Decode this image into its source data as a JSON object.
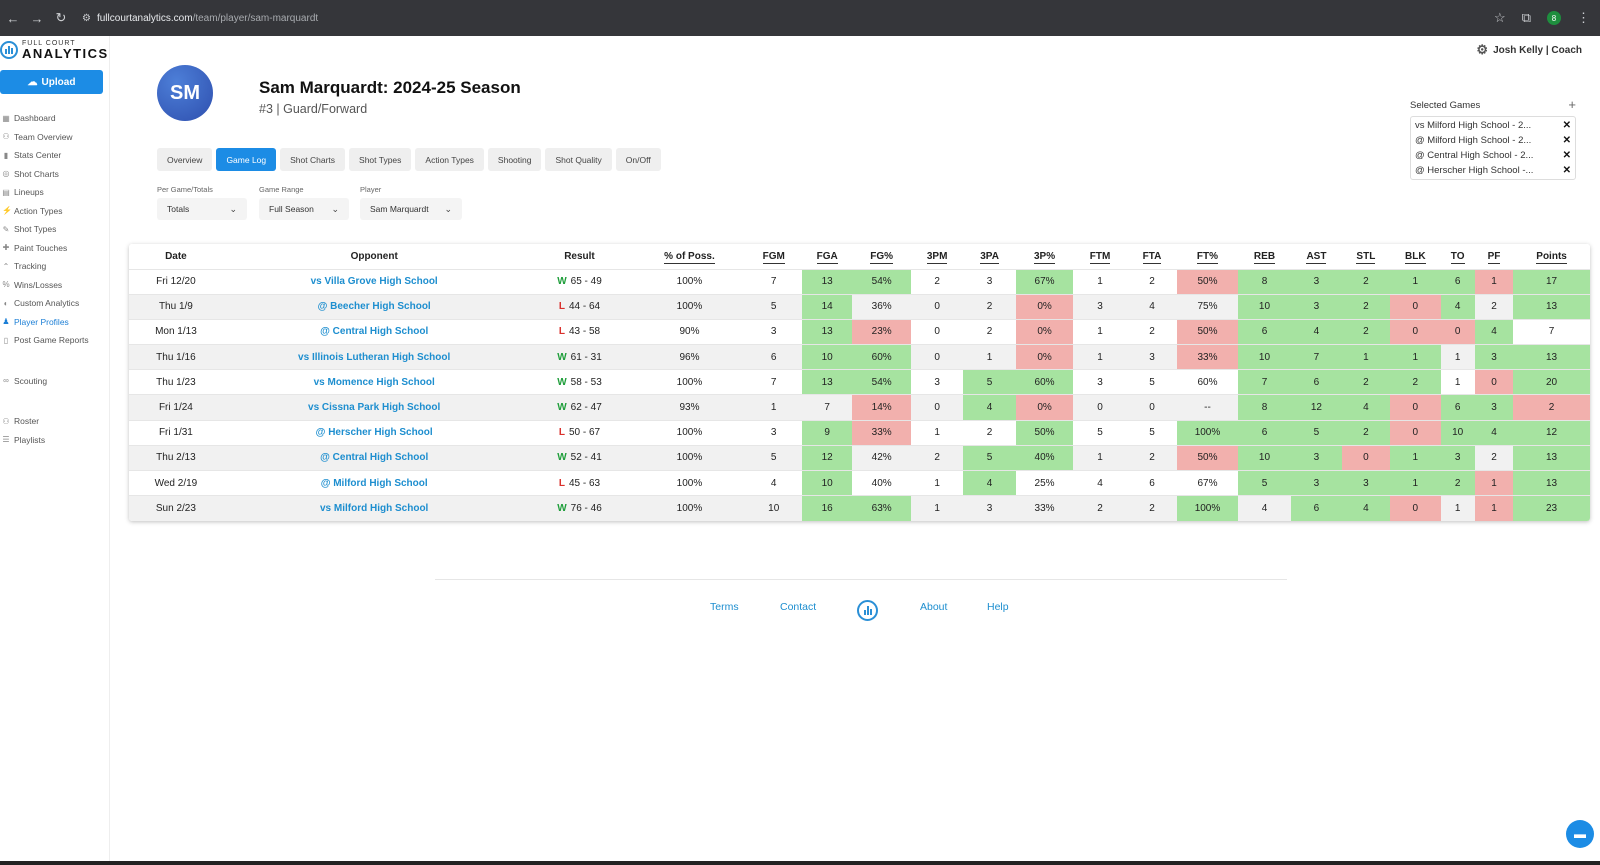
{
  "browser": {
    "url_host": "fullcourtanalytics.com",
    "url_path": "/team/player/sam-marquardt",
    "profile_initial": "8"
  },
  "logo": {
    "top": "FULL COURT",
    "bottom": "ANALYTICS"
  },
  "upload_label": "Upload",
  "sidebar": {
    "items": [
      {
        "label": "Dashboard",
        "icon": "dashboard-icon",
        "glyph": "▦"
      },
      {
        "label": "Team Overview",
        "icon": "team-icon",
        "glyph": "⚇"
      },
      {
        "label": "Stats Center",
        "icon": "stats-icon",
        "glyph": "▮"
      },
      {
        "label": "Shot Charts",
        "icon": "target-icon",
        "glyph": "◎"
      },
      {
        "label": "Lineups",
        "icon": "lineups-icon",
        "glyph": "▤"
      },
      {
        "label": "Action Types",
        "icon": "action-icon",
        "glyph": "⚡"
      },
      {
        "label": "Shot Types",
        "icon": "shot-icon",
        "glyph": "✎"
      },
      {
        "label": "Paint Touches",
        "icon": "paint-icon",
        "glyph": "✚"
      },
      {
        "label": "Tracking",
        "icon": "tracking-icon",
        "glyph": "⌃"
      },
      {
        "label": "Wins/Losses",
        "icon": "percent-icon",
        "glyph": "%"
      },
      {
        "label": "Custom Analytics",
        "icon": "custom-icon",
        "glyph": "◐"
      },
      {
        "label": "Player Profiles",
        "icon": "person-icon",
        "glyph": "♟"
      },
      {
        "label": "Post Game Reports",
        "icon": "report-icon",
        "glyph": "▯"
      }
    ],
    "items2": [
      {
        "label": "Scouting",
        "icon": "binoculars-icon",
        "glyph": "∞"
      }
    ],
    "items3": [
      {
        "label": "Roster",
        "icon": "roster-icon",
        "glyph": "⚇"
      },
      {
        "label": "Playlists",
        "icon": "playlist-icon",
        "glyph": "☰"
      }
    ]
  },
  "user": {
    "name": "Josh Kelly | Coach"
  },
  "player": {
    "initials": "SM",
    "title": "Sam Marquardt: 2024-25 Season",
    "subtitle": "#3 | Guard/Forward"
  },
  "tabs": [
    "Overview",
    "Game Log",
    "Shot Charts",
    "Shot Types",
    "Action Types",
    "Shooting",
    "Shot Quality",
    "On/Off"
  ],
  "filters": {
    "per_game": {
      "label": "Per Game/Totals",
      "value": "Totals"
    },
    "range": {
      "label": "Game Range",
      "value": "Full Season"
    },
    "player": {
      "label": "Player",
      "value": "Sam Marquardt"
    }
  },
  "selected_games": {
    "title": "Selected Games",
    "items": [
      "vs Milford High School - 2...",
      "@ Milford High School - 2...",
      "@ Central High School - 2...",
      "@ Herscher High School -..."
    ]
  },
  "table": {
    "headers": [
      "Date",
      "Opponent",
      "Result",
      "% of Poss.",
      "FGM",
      "FGA",
      "FG%",
      "3PM",
      "3PA",
      "3P%",
      "FTM",
      "FTA",
      "FT%",
      "REB",
      "AST",
      "STL",
      "BLK",
      "TO",
      "PF",
      "Points"
    ],
    "rows": [
      {
        "date": "Fri 12/20",
        "opp": "vs Villa Grove High School",
        "wl": "W",
        "score": "65 - 49",
        "poss": "100%",
        "fgm": "7",
        "fga": "13",
        "fgp": "54%",
        "tpm": "2",
        "tpa": "3",
        "tpp": "67%",
        "ftm": "1",
        "fta": "2",
        "ftp": "50%",
        "reb": "8",
        "ast": "3",
        "stl": "2",
        "blk": "1",
        "to": "6",
        "pf": "1",
        "pts": "17",
        "hl": {
          "fga": "g",
          "fgp": "g",
          "tpp": "g",
          "ftp": "r",
          "reb": "g",
          "ast": "g",
          "stl": "g",
          "blk": "g",
          "to": "g",
          "pf": "r",
          "pts": "g"
        }
      },
      {
        "date": "Thu 1/9",
        "opp": "@ Beecher High School",
        "wl": "L",
        "score": "44 - 64",
        "poss": "100%",
        "fgm": "5",
        "fga": "14",
        "fgp": "36%",
        "tpm": "0",
        "tpa": "2",
        "tpp": "0%",
        "ftm": "3",
        "fta": "4",
        "ftp": "75%",
        "reb": "10",
        "ast": "3",
        "stl": "2",
        "blk": "0",
        "to": "4",
        "pf": "2",
        "pts": "13",
        "hl": {
          "fga": "g",
          "tpp": "r",
          "reb": "g",
          "ast": "g",
          "stl": "g",
          "blk": "r",
          "to": "g",
          "pts": "g"
        }
      },
      {
        "date": "Mon 1/13",
        "opp": "@ Central High School",
        "wl": "L",
        "score": "43 - 58",
        "poss": "90%",
        "fgm": "3",
        "fga": "13",
        "fgp": "23%",
        "tpm": "0",
        "tpa": "2",
        "tpp": "0%",
        "ftm": "1",
        "fta": "2",
        "ftp": "50%",
        "reb": "6",
        "ast": "4",
        "stl": "2",
        "blk": "0",
        "to": "0",
        "pf": "4",
        "pts": "7",
        "hl": {
          "fga": "g",
          "fgp": "r",
          "tpp": "r",
          "ftp": "r",
          "reb": "g",
          "ast": "g",
          "stl": "g",
          "blk": "r",
          "to": "r",
          "pf": "g"
        }
      },
      {
        "date": "Thu 1/16",
        "opp": "vs Illinois Lutheran High School",
        "wl": "W",
        "score": "61 - 31",
        "poss": "96%",
        "fgm": "6",
        "fga": "10",
        "fgp": "60%",
        "tpm": "0",
        "tpa": "1",
        "tpp": "0%",
        "ftm": "1",
        "fta": "3",
        "ftp": "33%",
        "reb": "10",
        "ast": "7",
        "stl": "1",
        "blk": "1",
        "to": "1",
        "pf": "3",
        "pts": "13",
        "hl": {
          "fga": "g",
          "fgp": "g",
          "tpp": "r",
          "ftp": "r",
          "reb": "g",
          "ast": "g",
          "stl": "g",
          "blk": "g",
          "pf": "g",
          "pts": "g"
        }
      },
      {
        "date": "Thu 1/23",
        "opp": "vs Momence High School",
        "wl": "W",
        "score": "58 - 53",
        "poss": "100%",
        "fgm": "7",
        "fga": "13",
        "fgp": "54%",
        "tpm": "3",
        "tpa": "5",
        "tpp": "60%",
        "ftm": "3",
        "fta": "5",
        "ftp": "60%",
        "reb": "7",
        "ast": "6",
        "stl": "2",
        "blk": "2",
        "to": "1",
        "pf": "0",
        "pts": "20",
        "hl": {
          "fga": "g",
          "fgp": "g",
          "tpa": "g",
          "tpp": "g",
          "reb": "g",
          "ast": "g",
          "stl": "g",
          "blk": "g",
          "pf": "r",
          "pts": "g"
        }
      },
      {
        "date": "Fri 1/24",
        "opp": "vs Cissna Park High School",
        "wl": "W",
        "score": "62 - 47",
        "poss": "93%",
        "fgm": "1",
        "fga": "7",
        "fgp": "14%",
        "tpm": "0",
        "tpa": "4",
        "tpp": "0%",
        "ftm": "0",
        "fta": "0",
        "ftp": "--",
        "reb": "8",
        "ast": "12",
        "stl": "4",
        "blk": "0",
        "to": "6",
        "pf": "3",
        "pts": "2",
        "hl": {
          "fgp": "r",
          "tpa": "g",
          "tpp": "r",
          "reb": "g",
          "ast": "g",
          "stl": "g",
          "blk": "r",
          "to": "g",
          "pf": "g",
          "pts": "r"
        }
      },
      {
        "date": "Fri 1/31",
        "opp": "@ Herscher High School",
        "wl": "L",
        "score": "50 - 67",
        "poss": "100%",
        "fgm": "3",
        "fga": "9",
        "fgp": "33%",
        "tpm": "1",
        "tpa": "2",
        "tpp": "50%",
        "ftm": "5",
        "fta": "5",
        "ftp": "100%",
        "reb": "6",
        "ast": "5",
        "stl": "2",
        "blk": "0",
        "to": "10",
        "pf": "4",
        "pts": "12",
        "hl": {
          "fga": "g",
          "fgp": "r",
          "tpp": "g",
          "ftp": "g",
          "reb": "g",
          "ast": "g",
          "stl": "g",
          "blk": "r",
          "to": "g",
          "pf": "g",
          "pts": "g"
        }
      },
      {
        "date": "Thu 2/13",
        "opp": "@ Central High School",
        "wl": "W",
        "score": "52 - 41",
        "poss": "100%",
        "fgm": "5",
        "fga": "12",
        "fgp": "42%",
        "tpm": "2",
        "tpa": "5",
        "tpp": "40%",
        "ftm": "1",
        "fta": "2",
        "ftp": "50%",
        "reb": "10",
        "ast": "3",
        "stl": "0",
        "blk": "1",
        "to": "3",
        "pf": "2",
        "pts": "13",
        "hl": {
          "fga": "g",
          "tpa": "g",
          "tpp": "g",
          "ftp": "r",
          "reb": "g",
          "ast": "g",
          "stl": "r",
          "blk": "g",
          "to": "g",
          "pts": "g"
        }
      },
      {
        "date": "Wed 2/19",
        "opp": "@ Milford High School",
        "wl": "L",
        "score": "45 - 63",
        "poss": "100%",
        "fgm": "4",
        "fga": "10",
        "fgp": "40%",
        "tpm": "1",
        "tpa": "4",
        "tpp": "25%",
        "ftm": "4",
        "fta": "6",
        "ftp": "67%",
        "reb": "5",
        "ast": "3",
        "stl": "3",
        "blk": "1",
        "to": "2",
        "pf": "1",
        "pts": "13",
        "hl": {
          "fga": "g",
          "tpa": "g",
          "reb": "g",
          "ast": "g",
          "stl": "g",
          "blk": "g",
          "to": "g",
          "pf": "r",
          "pts": "g"
        }
      },
      {
        "date": "Sun 2/23",
        "opp": "vs Milford High School",
        "wl": "W",
        "score": "76 - 46",
        "poss": "100%",
        "fgm": "10",
        "fga": "16",
        "fgp": "63%",
        "tpm": "1",
        "tpa": "3",
        "tpp": "33%",
        "ftm": "2",
        "fta": "2",
        "ftp": "100%",
        "reb": "4",
        "ast": "6",
        "stl": "4",
        "blk": "0",
        "to": "1",
        "pf": "1",
        "pts": "23",
        "hl": {
          "fga": "g",
          "fgp": "g",
          "ftp": "g",
          "ast": "g",
          "stl": "g",
          "blk": "r",
          "pf": "r",
          "pts": "g"
        }
      }
    ]
  },
  "footer": {
    "terms": "Terms",
    "contact": "Contact",
    "about": "About",
    "help": "Help"
  },
  "colors": {
    "accent": "#1c8ce5",
    "good": "#a6e3a0",
    "bad": "#f2b0ad",
    "win": "#1e9e3a",
    "loss": "#d9302c"
  }
}
